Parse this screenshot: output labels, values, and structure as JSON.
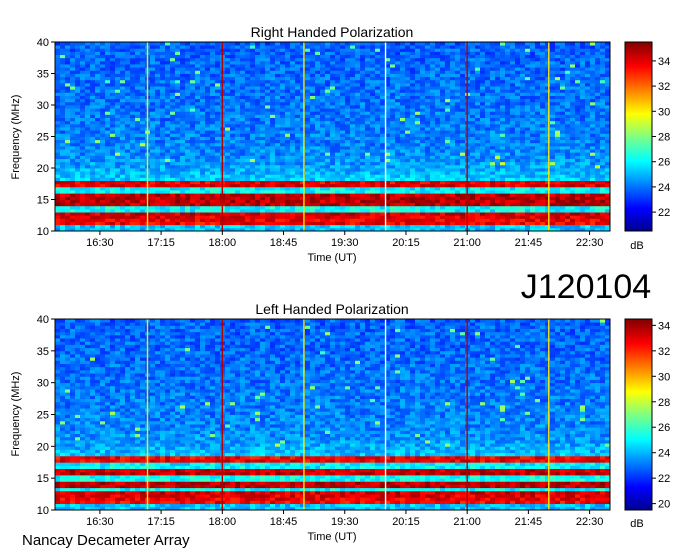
{
  "observation_label": "J120104",
  "footer": "Nancay Decameter Array",
  "chart_data": [
    {
      "type": "heatmap",
      "title": "Right Handed Polarization",
      "xlabel": "Time (UT)",
      "ylabel": "Frequency (MHz)",
      "x_ticks": [
        "16:30",
        "17:15",
        "18:00",
        "18:45",
        "19:30",
        "20:15",
        "21:00",
        "21:45",
        "22:30"
      ],
      "x_tick_minutes": [
        990,
        1035,
        1080,
        1125,
        1170,
        1215,
        1260,
        1305,
        1350
      ],
      "x_range_minutes": [
        957,
        1365
      ],
      "y_ticks": [
        "10",
        "15",
        "20",
        "25",
        "30",
        "35",
        "40"
      ],
      "ylim": [
        10,
        40
      ],
      "colorbar": {
        "label": "dB",
        "ticks": [
          "22",
          "24",
          "26",
          "28",
          "30",
          "32",
          "34"
        ],
        "range": [
          20.5,
          35.5
        ]
      },
      "bright_bands_mhz": [
        11.5,
        12.5,
        14.5,
        15.5,
        17.5
      ],
      "vertical_markers": [
        {
          "time": "17:05",
          "color": "#ffe600"
        },
        {
          "time": "18:00",
          "color": "#b40000"
        },
        {
          "time": "19:00",
          "color": "#ffe600"
        },
        {
          "time": "20:00",
          "color": "#ffffff"
        },
        {
          "time": "21:00",
          "color": "#b40000"
        },
        {
          "time": "22:00",
          "color": "#ffe600"
        }
      ]
    },
    {
      "type": "heatmap",
      "title": "Left Handed Polarization",
      "xlabel": "Time (UT)",
      "ylabel": "Frequency (MHz)",
      "x_ticks": [
        "16:30",
        "17:15",
        "18:00",
        "18:45",
        "19:30",
        "20:15",
        "21:00",
        "21:45",
        "22:30"
      ],
      "x_tick_minutes": [
        990,
        1035,
        1080,
        1125,
        1170,
        1215,
        1260,
        1305,
        1350
      ],
      "x_range_minutes": [
        957,
        1365
      ],
      "y_ticks": [
        "10",
        "15",
        "20",
        "25",
        "30",
        "35",
        "40"
      ],
      "ylim": [
        10,
        40
      ],
      "colorbar": {
        "label": "dB",
        "ticks": [
          "20",
          "22",
          "24",
          "26",
          "28",
          "30",
          "32",
          "34"
        ],
        "range": [
          19.5,
          34.5
        ]
      },
      "bright_bands_mhz": [
        11.5,
        12.5,
        14.0,
        16.0,
        18.0
      ],
      "vertical_markers": [
        {
          "time": "17:05",
          "color": "#ffe600"
        },
        {
          "time": "18:00",
          "color": "#b40000"
        },
        {
          "time": "19:00",
          "color": "#ffe600"
        },
        {
          "time": "20:00",
          "color": "#ffffff"
        },
        {
          "time": "21:00",
          "color": "#b40000"
        },
        {
          "time": "22:00",
          "color": "#ffe600"
        }
      ]
    }
  ]
}
